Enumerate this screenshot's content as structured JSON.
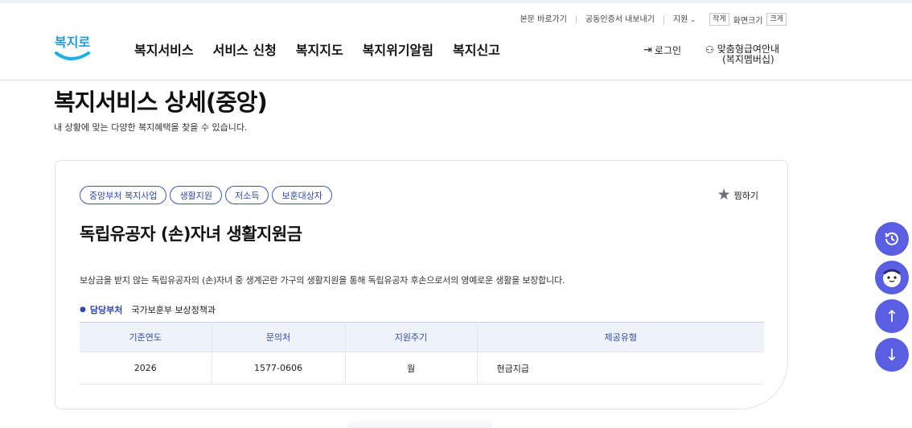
{
  "header": {
    "util_links": [
      "본문 바로가기",
      "공동인증서 내보내기"
    ],
    "region_label": "지원",
    "font_small": "작게",
    "font_size_label": "화면크기",
    "font_large": "크게",
    "logo_text": "복지로",
    "gnb": [
      "복지서비스",
      "서비스 신청",
      "복지지도",
      "복지위기알림",
      "복지신고"
    ],
    "login": "로그인",
    "member_line1": "맞춤형급여안내",
    "member_line2": "(복지멤버십)"
  },
  "page": {
    "title": "복지서비스 상세(중앙)",
    "description": "내 상황에 맞는 다양한 복지혜택을 찾을 수 있습니다."
  },
  "service": {
    "tags": [
      "중앙부처 복지사업",
      "생활지원",
      "저소득",
      "보훈대상자"
    ],
    "favorite_label": "찜하기",
    "title": "독립유공자 (손)자녀 생활지원금",
    "description": "보상금을 받지 않는 독립유공자의 (손)자녀 중 생계곤란 가구의 생활지원을 통해 독립유공자 후손으로서의 영예로운 생활을 보장합니다.",
    "dept_label": "담당부처",
    "dept_value": "국가보훈부 보상정책과",
    "table": {
      "headers": [
        "기준연도",
        "문의처",
        "지원주기",
        "제공유형"
      ],
      "row": [
        "2026",
        "1577-0606",
        "월",
        "현금지급"
      ]
    }
  },
  "colors": {
    "brand": "#2f4aa8",
    "fab": "#5a5ee0",
    "table_header_bg": "#eef2f9"
  },
  "fabs": [
    "history-icon",
    "chatbot-icon",
    "arrow-up-icon",
    "arrow-down-icon"
  ]
}
